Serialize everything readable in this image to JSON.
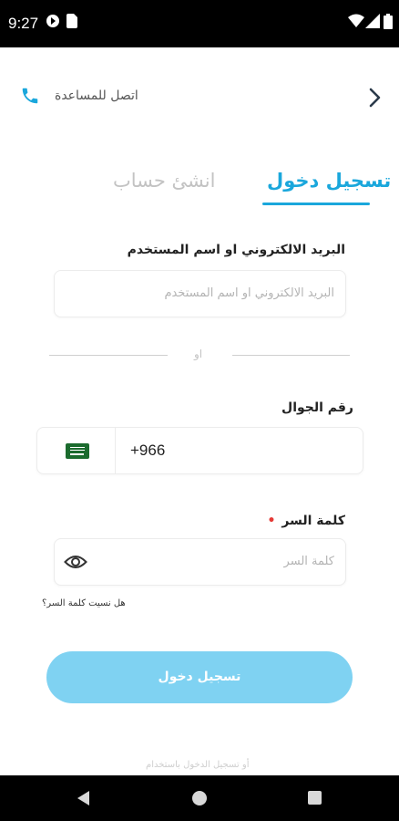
{
  "status_bar": {
    "time": "9:27",
    "icons": [
      "circle-status-icon",
      "sim-card-icon",
      "wifi-icon",
      "signal-icon",
      "battery-icon"
    ]
  },
  "header": {
    "help_label": "اتصل للمساعدة",
    "help_icon": "phone-icon",
    "back_icon": "chevron-right-icon"
  },
  "tabs": {
    "login_label": "تسجيل دخول",
    "signup_label": "انشئ حساب",
    "active": "login"
  },
  "form": {
    "email_label": "البريد الالكتروني او اسم المستخدم",
    "email_placeholder": "البريد الالكتروني او اسم المستخدم",
    "or_label": "او",
    "phone_label": "رقم الجوال",
    "phone_country_flag": "saudi-flag-icon",
    "phone_value": "+966",
    "password_label": "كلمة السر",
    "password_required_mark": "•",
    "password_placeholder": "كلمة السر",
    "forgot_password": "هل نسيت كلمة السر؟",
    "submit_label": "تسجيل دخول",
    "alt_login_hint": "أو تسجيل الدخول باستخدام"
  },
  "colors": {
    "accent": "#1aa7dc",
    "button": "#7fd2f2",
    "inactive_tab": "#c3c3c3",
    "required": "#e53935"
  },
  "nav_bar": {
    "icons": [
      "back-triangle-icon",
      "home-circle-icon",
      "recent-square-icon"
    ]
  }
}
